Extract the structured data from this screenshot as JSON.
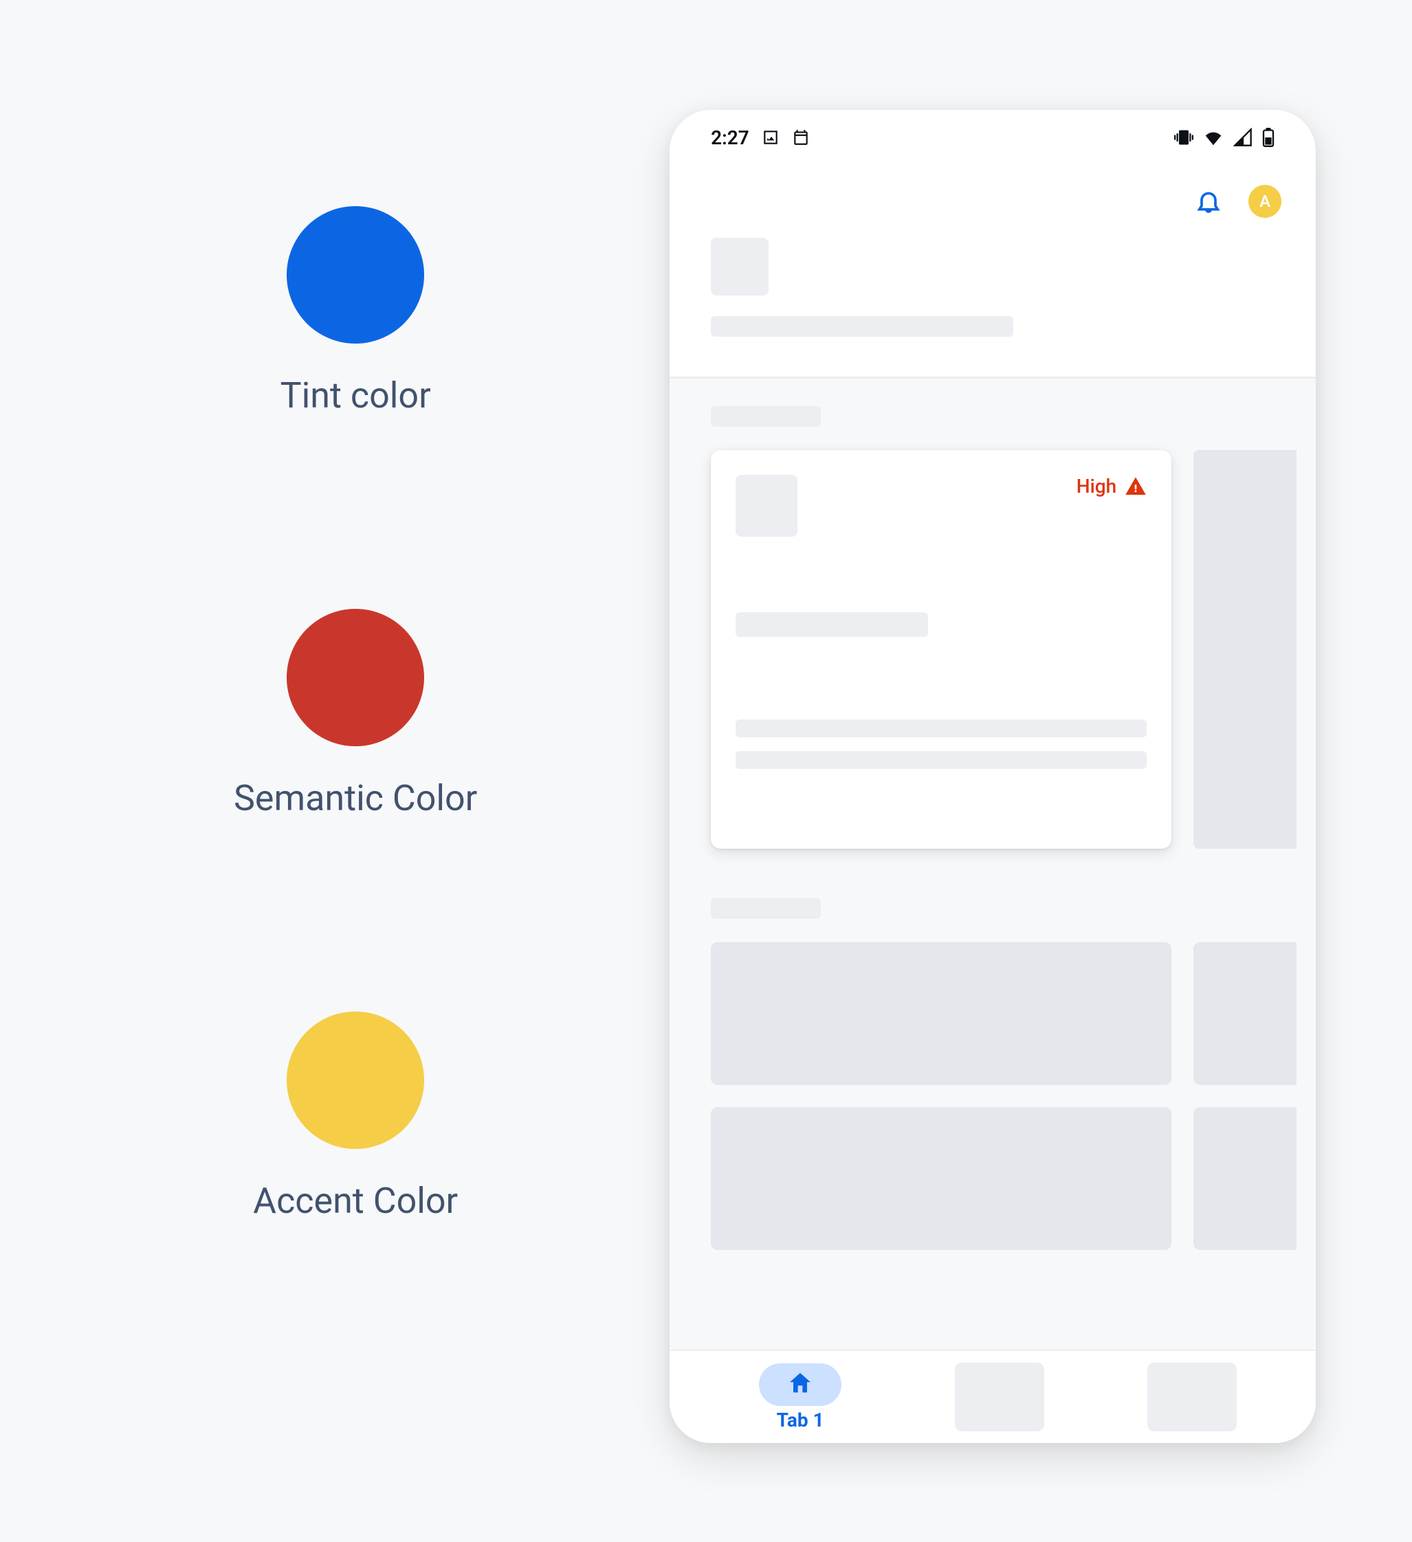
{
  "legend": {
    "tint": {
      "label": "Tint color",
      "hex": "#0c66e4"
    },
    "semantic": {
      "label": "Semantic Color",
      "hex": "#c9372c"
    },
    "accent": {
      "label": "Accent Color",
      "hex": "#f5cd47"
    }
  },
  "statusbar": {
    "time": "2:27",
    "media_icon": "image-icon",
    "calendar_icon": "calendar-icon",
    "vibrate_icon": "vibrate-icon",
    "wifi_icon": "wifi-icon",
    "signal_icon": "signal-icon",
    "battery_icon": "battery-icon"
  },
  "topbar": {
    "notification_icon": "bell-icon",
    "avatar_initial": "A"
  },
  "card": {
    "priority_label": "High"
  },
  "bottomnav": {
    "tab1": {
      "label": "Tab 1",
      "active": true
    }
  }
}
